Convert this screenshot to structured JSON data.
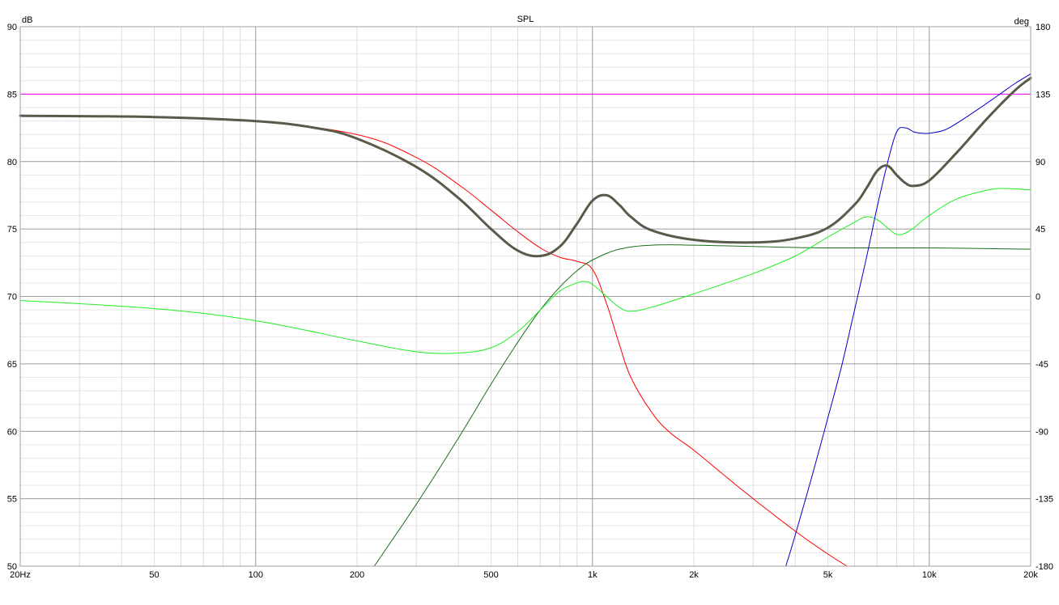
{
  "chart_data": {
    "type": "line",
    "title": "SPL",
    "ylabel_left": "dB",
    "ylabel_right": "deg",
    "x_scale": "log",
    "xlim": [
      20,
      20000
    ],
    "ylim_left": [
      50,
      90
    ],
    "ylim_right": [
      -180,
      180
    ],
    "grid": true,
    "x_ticks": [
      {
        "v": 20,
        "label": "20Hz"
      },
      {
        "v": 50,
        "label": "50"
      },
      {
        "v": 100,
        "label": "100"
      },
      {
        "v": 200,
        "label": "200"
      },
      {
        "v": 500,
        "label": "500"
      },
      {
        "v": 1000,
        "label": "1k"
      },
      {
        "v": 2000,
        "label": "2k"
      },
      {
        "v": 5000,
        "label": "5k"
      },
      {
        "v": 10000,
        "label": "10k"
      },
      {
        "v": 20000,
        "label": "20k"
      }
    ],
    "y_ticks_left": [
      "50",
      "55",
      "60",
      "65",
      "70",
      "75",
      "80",
      "85",
      "90"
    ],
    "y_ticks_right": [
      "-180",
      "-135",
      "-90",
      "-45",
      "0",
      "45",
      "90",
      "135",
      "180"
    ],
    "series": [
      {
        "color": "#ff00ff",
        "width": 1,
        "axis": "left",
        "x": [
          20,
          20000
        ],
        "y": [
          85,
          85
        ]
      },
      {
        "color": "#ff0000",
        "width": 1,
        "axis": "left",
        "x": [
          20,
          50,
          100,
          200,
          300,
          400,
          500,
          600,
          700,
          800,
          900,
          1000,
          1100,
          1200,
          1300,
          1500,
          1700,
          2000,
          2500,
          3000,
          4000,
          5000,
          5700
        ],
        "y": [
          83.4,
          83.3,
          83.0,
          82.0,
          80.3,
          78.3,
          76.4,
          74.8,
          73.6,
          72.9,
          72.6,
          72.0,
          69.5,
          66.5,
          64.0,
          61.4,
          59.9,
          58.6,
          56.6,
          55.0,
          52.6,
          50.9,
          50.0
        ]
      },
      {
        "color": "#1a6e1a",
        "width": 1,
        "axis": "left",
        "x": [
          225,
          300,
          400,
          500,
          600,
          700,
          800,
          900,
          1000,
          1200,
          1500,
          2000,
          3000,
          5000,
          10000,
          20000
        ],
        "y": [
          50.0,
          54.6,
          59.5,
          63.5,
          66.6,
          69.0,
          70.7,
          71.9,
          72.7,
          73.5,
          73.8,
          73.8,
          73.7,
          73.6,
          73.6,
          73.5
        ]
      },
      {
        "color": "#22ee22",
        "width": 1,
        "axis": "left",
        "x": [
          20,
          50,
          100,
          200,
          300,
          400,
          500,
          600,
          700,
          800,
          900,
          950,
          1000,
          1100,
          1200,
          1300,
          1500,
          2000,
          3000,
          4000,
          5000,
          6000,
          6500,
          7000,
          7500,
          8000,
          8500,
          9000,
          10000,
          12000,
          15000,
          17000,
          20000
        ],
        "y": [
          69.7,
          69.1,
          68.2,
          66.7,
          65.9,
          65.8,
          66.2,
          67.4,
          69.0,
          70.4,
          71.0,
          71.1,
          70.9,
          70.0,
          69.2,
          68.9,
          69.2,
          70.2,
          71.7,
          73.0,
          74.4,
          75.5,
          75.9,
          75.7,
          75.1,
          74.6,
          74.7,
          75.1,
          76.0,
          77.2,
          77.9,
          78.0,
          77.9
        ]
      },
      {
        "color": "#0000cc",
        "width": 1,
        "axis": "left",
        "x": [
          3750,
          4000,
          4500,
          5000,
          5500,
          6000,
          6500,
          7000,
          7500,
          8000,
          8500,
          9000,
          9500,
          10000,
          11000,
          12000,
          14000,
          16000,
          18000,
          20000
        ],
        "y": [
          50.0,
          52.3,
          56.8,
          61.0,
          64.9,
          69.0,
          72.8,
          76.6,
          79.8,
          82.2,
          82.5,
          82.2,
          82.1,
          82.1,
          82.3,
          82.8,
          83.9,
          84.9,
          85.8,
          86.5
        ]
      },
      {
        "color": "#5a5a4a",
        "width": 3,
        "axis": "left",
        "x": [
          20,
          50,
          100,
          150,
          200,
          300,
          400,
          500,
          600,
          700,
          800,
          900,
          1000,
          1100,
          1200,
          1300,
          1500,
          2000,
          3000,
          4000,
          5000,
          6000,
          6500,
          7000,
          7500,
          8000,
          8500,
          9000,
          10000,
          12000,
          15000,
          18000,
          20000
        ],
        "y": [
          83.4,
          83.3,
          83.0,
          82.5,
          81.7,
          79.6,
          77.3,
          75.0,
          73.4,
          73.0,
          73.7,
          75.4,
          77.1,
          77.5,
          76.8,
          75.9,
          74.9,
          74.2,
          74.0,
          74.3,
          75.1,
          76.8,
          78.0,
          79.3,
          79.7,
          79.0,
          78.4,
          78.2,
          78.6,
          80.6,
          83.3,
          85.3,
          86.2
        ]
      }
    ]
  }
}
